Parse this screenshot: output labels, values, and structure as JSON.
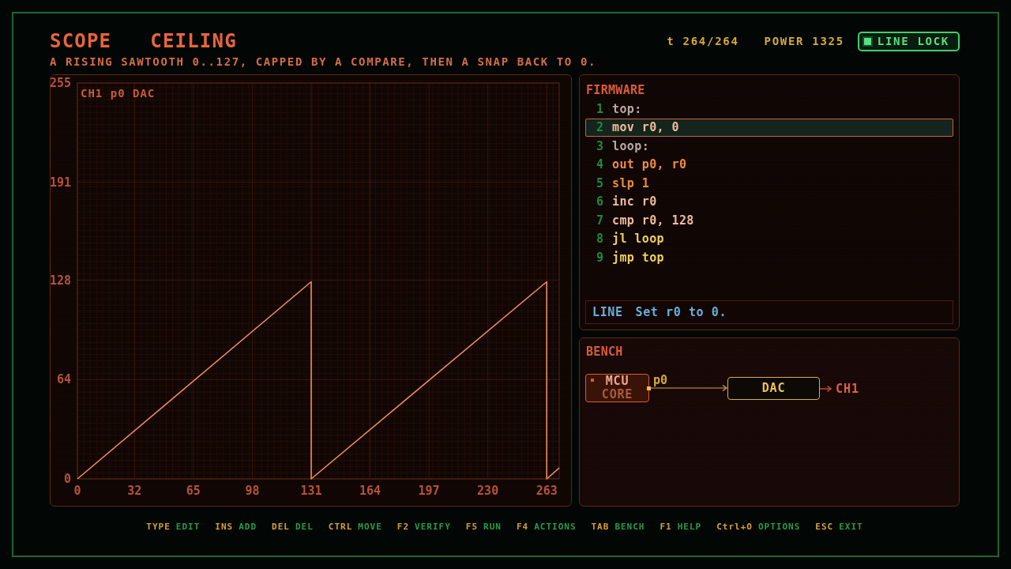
{
  "header": {
    "heading": [
      "SCOPE",
      "CEILING"
    ],
    "subtitle": "A RISING SAWTOOTH 0..127, CAPPED BY A COMPARE, THEN A SNAP BACK TO 0.",
    "tick": "t 264/264",
    "power": "POWER 1325",
    "line_lock": {
      "label": "LINE LOCK",
      "on": true
    }
  },
  "scope": {
    "chart_data": {
      "type": "line",
      "title": "CH1 p0 DAC",
      "x": [
        0,
        131,
        131,
        263,
        263,
        270
      ],
      "values": [
        0,
        127,
        0,
        127,
        0,
        7
      ],
      "xlim": [
        0,
        270
      ],
      "ylim": [
        0,
        255
      ],
      "xticks": [
        0,
        32,
        65,
        98,
        131,
        164,
        197,
        230,
        263
      ],
      "yticks": [
        0,
        64,
        128,
        191,
        255
      ],
      "grid": true
    }
  },
  "firmware": {
    "title": "FIRMWARE",
    "lines": [
      {
        "number": "1",
        "code": "top:",
        "kind": "label",
        "selected": false
      },
      {
        "number": "2",
        "code": "mov r0, 0",
        "kind": "data",
        "selected": true
      },
      {
        "number": "3",
        "code": "loop:",
        "kind": "label",
        "selected": false
      },
      {
        "number": "4",
        "code": "out p0, r0",
        "kind": "io",
        "selected": false
      },
      {
        "number": "5",
        "code": "slp 1",
        "kind": "io",
        "selected": false
      },
      {
        "number": "6",
        "code": "inc r0",
        "kind": "data",
        "selected": false
      },
      {
        "number": "7",
        "code": "cmp r0, 128",
        "kind": "data",
        "selected": false
      },
      {
        "number": "8",
        "code": "jl loop",
        "kind": "jump",
        "selected": false
      },
      {
        "number": "9",
        "code": "jmp top",
        "kind": "jump",
        "selected": false
      }
    ],
    "info": {
      "label": "LINE",
      "text": "Set r0 to 0."
    }
  },
  "bench": {
    "title": "BENCH",
    "nodes": [
      {
        "kind": "core",
        "lines": [
          "MCU",
          "CORE"
        ]
      },
      {
        "kind": "device",
        "lines": [
          "DAC"
        ]
      }
    ],
    "port": "p0",
    "output": "CH1"
  },
  "footer": {
    "hints": [
      {
        "key": "TYPE",
        "action": "EDIT"
      },
      {
        "key": "INS",
        "action": "ADD"
      },
      {
        "key": "DEL",
        "action": "DEL"
      },
      {
        "key": "CTRL",
        "action": "MOVE"
      },
      {
        "key": "F2",
        "action": "VERIFY"
      },
      {
        "key": "F5",
        "action": "RUN"
      },
      {
        "key": "F4",
        "action": "ACTIONS"
      },
      {
        "key": "TAB",
        "action": "BENCH"
      },
      {
        "key": "F1",
        "action": "HELP"
      },
      {
        "key": "Ctrl+O",
        "action": "OPTIONS"
      },
      {
        "key": "ESC",
        "action": "EXIT"
      }
    ]
  }
}
